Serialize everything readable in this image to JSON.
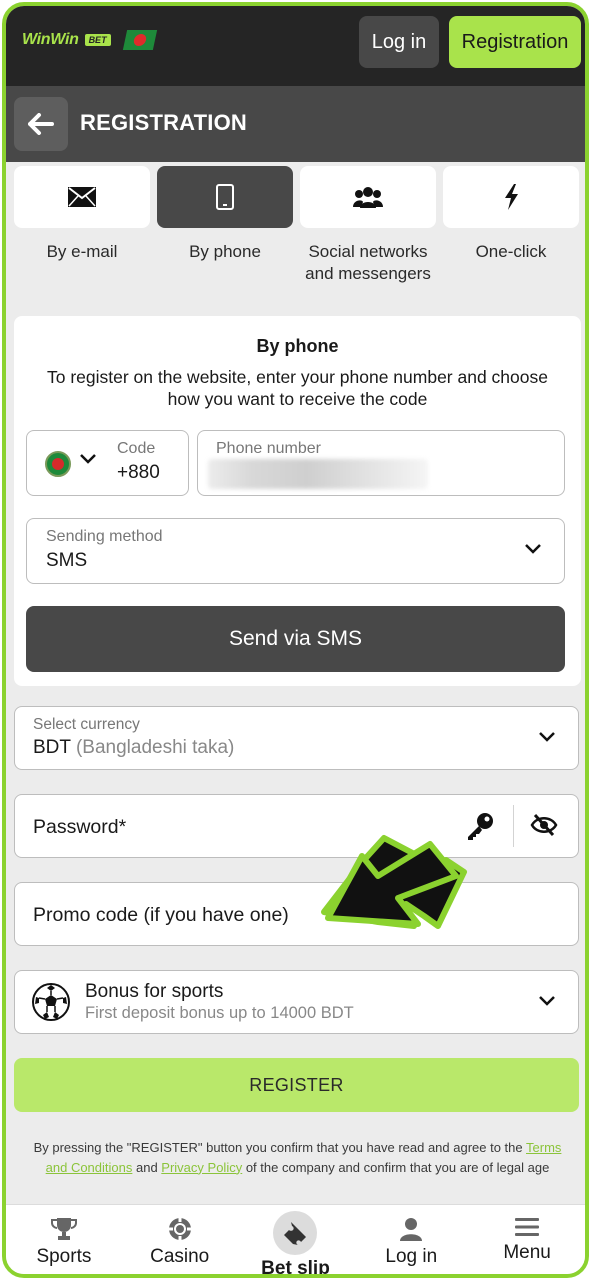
{
  "header": {
    "logo_text": "WinWin",
    "logo_badge": "BET",
    "login_label": "Log in",
    "register_label": "Registration"
  },
  "titlebar": {
    "title": "REGISTRATION"
  },
  "tabs": [
    {
      "label": "By e-mail",
      "icon": "envelope-icon"
    },
    {
      "label": "By phone",
      "icon": "phone-icon",
      "active": true
    },
    {
      "label": "Social networks and messengers",
      "icon": "users-icon"
    },
    {
      "label": "One-click",
      "icon": "lightning-icon"
    }
  ],
  "phone_form": {
    "title": "By phone",
    "description": "To register on the website, enter your phone number and choose how you want to receive the code",
    "code_label": "Code",
    "code_value": "+880",
    "phone_label": "Phone number",
    "method_label": "Sending method",
    "method_value": "SMS",
    "send_label": "Send via SMS"
  },
  "currency": {
    "label": "Select currency",
    "code": "BDT",
    "name": "(Bangladeshi taka)"
  },
  "password": {
    "placeholder": "Password*"
  },
  "promo": {
    "placeholder": "Promo code (if you have one)"
  },
  "bonus": {
    "title": "Bonus for sports",
    "subtitle": "First deposit bonus up to 14000 BDT"
  },
  "register_label": "REGISTER",
  "terms": {
    "before": "By pressing the \"REGISTER\" button you confirm that you have read and agree to the ",
    "link1": "Terms and Conditions",
    "and": " and ",
    "link2": "Privacy Policy",
    "after": " of the company and confirm that you are of legal age"
  },
  "bottom_nav": [
    {
      "label": "Sports",
      "icon": "trophy-icon"
    },
    {
      "label": "Casino",
      "icon": "chip-icon"
    },
    {
      "label": "Bet slip",
      "icon": "ticket-icon"
    },
    {
      "label": "Log in",
      "icon": "user-icon"
    },
    {
      "label": "Menu",
      "icon": "menu-icon"
    }
  ],
  "colors": {
    "accent": "#a9e34b",
    "dark": "#252525",
    "panel": "#484848",
    "frame_border": "#8bd22f"
  }
}
